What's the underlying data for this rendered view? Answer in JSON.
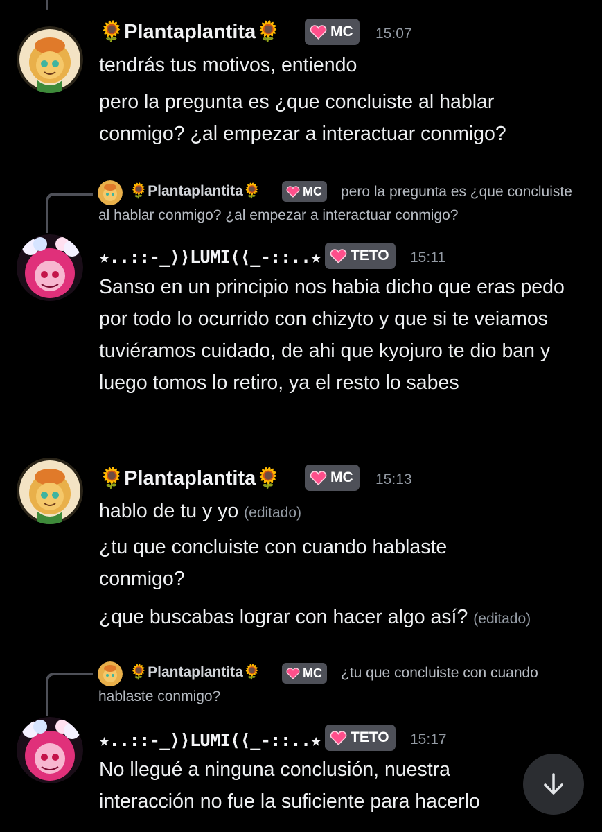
{
  "colors": {
    "background": "#000000",
    "badge_bg": "#4e5058",
    "heart_pink": "#ff4f8b",
    "timestamp": "#949ba4",
    "scroll_button": "#2b2d31"
  },
  "icons": {
    "heart": "heart-icon",
    "sunflower": "sunflower-icon",
    "scroll_down": "arrow-down-icon"
  },
  "messages": [
    {
      "author": "🌻Plantaplantita🌻",
      "badge": "MC",
      "time": "15:07",
      "lines": [
        "tendrás tus motivos, entiendo",
        "pero la pregunta es ¿que concluiste al hablar conmigo? ¿al empezar a interactuar conmigo?"
      ]
    },
    {
      "reply": {
        "author": "🌻Plantaplantita🌻",
        "badge": "MC",
        "text": "pero la pregunta es ¿que concluiste al hablar conmigo? ¿al empezar a interactuar conmigo?"
      },
      "author": "★..::-_⟩⟩LUMI⟨⟨_-::..★",
      "badge": "TETO",
      "time": "15:11",
      "lines": [
        "Sanso en un principio nos habia dicho que eras pedo por todo lo ocurrido con chizyto y que si te veiamos tuviéramos cuidado, de ahi que kyojuro te dio ban y luego tomos lo retiro, ya el resto lo sabes"
      ]
    },
    {
      "author": "🌻Plantaplantita🌻",
      "badge": "MC",
      "time": "15:13",
      "lines": [
        "hablo de tu y yo",
        "¿tu que concluiste con cuando hablaste conmigo?",
        "¿que buscabas lograr con hacer algo así?"
      ],
      "edited": "(editado)"
    },
    {
      "reply": {
        "author": "🌻Plantaplantita🌻",
        "badge": "MC",
        "text": "¿tu que concluiste con cuando hablaste conmigo?"
      },
      "author": "★..::-_⟩⟩LUMI⟨⟨_-::..★",
      "badge": "TETO",
      "time": "15:17",
      "lines": [
        "No llegué a ninguna conclusión, nuestra interacción no fue la suficiente para hacerlo"
      ]
    }
  ]
}
